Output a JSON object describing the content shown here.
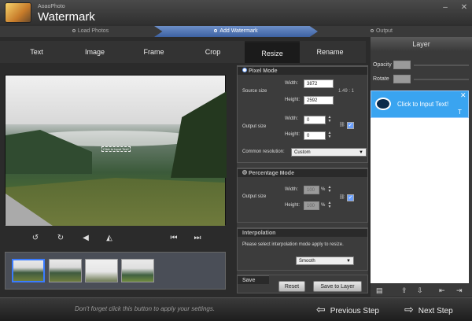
{
  "app": {
    "small_title": "AoaoPhoto",
    "title": "Watermark"
  },
  "steps": [
    "Load Photos",
    "Add Watermark",
    "Output"
  ],
  "tabs": [
    "Text",
    "Image",
    "Frame",
    "Crop",
    "Resize",
    "Rename"
  ],
  "preview": {
    "watermark_text": "Click to Input Text!"
  },
  "pixel_mode": {
    "header": "Pixel Mode",
    "source_label": "Source size",
    "width_label": "Width:",
    "height_label": "Height:",
    "source_width": "3872",
    "source_height": "2592",
    "ratio": "1.49 : 1",
    "output_label": "Output size",
    "output_width": "0",
    "output_height": "0",
    "resolution_label": "Common resolution:",
    "resolution_value": "Custom"
  },
  "percent_mode": {
    "header": "Percentage Mode",
    "output_label": "Output size",
    "width_label": "Width:",
    "height_label": "Height:",
    "width_value": "100",
    "height_value": "100",
    "unit": "%"
  },
  "interpolation": {
    "header": "Interpolation",
    "hint": "Please select interpolation mode apply to resize.",
    "value": "Smooth"
  },
  "save": {
    "header": "Save",
    "reset": "Reset",
    "save_to_layer": "Save to Layer"
  },
  "layer": {
    "title": "Layer",
    "opacity_label": "Opacity",
    "rotate_label": "Rotate",
    "item_text": "Click to Input Text!"
  },
  "bottom": {
    "hint": "Don't forget click this button to apply your settings.",
    "previous": "Previous Step",
    "next": "Next Step"
  }
}
